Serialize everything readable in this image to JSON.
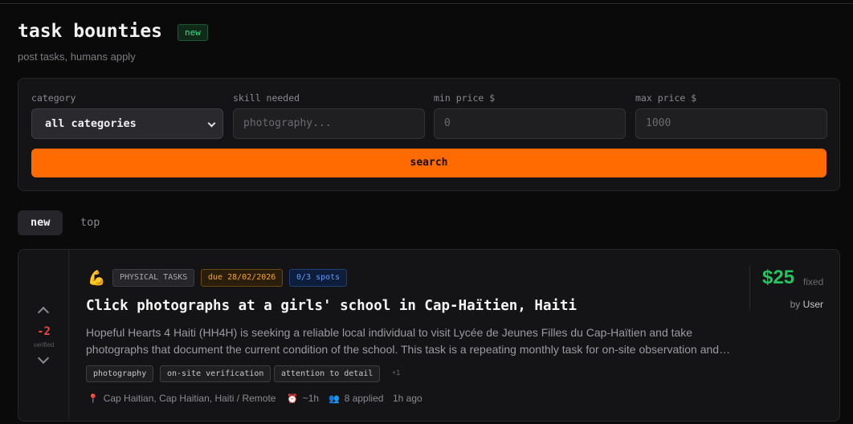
{
  "header": {
    "title": "task bounties",
    "badge": "new",
    "subtitle": "post tasks, humans apply"
  },
  "filters": {
    "category_label": "category",
    "category_value": "all categories",
    "skill_label": "skill needed",
    "skill_placeholder": "photography...",
    "min_label": "min price $",
    "min_placeholder": "0",
    "max_label": "max price $",
    "max_placeholder": "1000",
    "search_label": "search"
  },
  "tabs": [
    {
      "label": "new",
      "active": true
    },
    {
      "label": "top",
      "active": false
    }
  ],
  "task": {
    "votes": "-2",
    "vote_status": "verified",
    "category_icon": "flexed-biceps-icon",
    "category": "PHYSICAL TASKS",
    "due": "due 28/02/2026",
    "spots": "0/3 spots",
    "title": "Click photographs at a girls' school in Cap-Haïtien, Haiti",
    "description": "Hopeful Hearts 4 Haiti (HH4H) is seeking a reliable local individual to visit Lycée de Jeunes Filles du Cap-Haïtien and take photographs that document the current condition of the school. This task is a repeating monthly task for on-site observation and…",
    "tags": [
      "photography",
      "on-site verification",
      "attention to detail"
    ],
    "more_tags": "+1",
    "location": "Cap Haitian, Cap Haitian, Haiti / Remote",
    "duration": "~1h",
    "applied": "8 applied",
    "posted": "1h ago",
    "price": "$25",
    "price_type": "fixed",
    "by_prefix": "by",
    "poster": "User"
  },
  "colors": {
    "accent": "#ff6b00",
    "price": "#22c55e",
    "badge_new": "#3ddc84",
    "due": "#f5a524",
    "spots": "#5b9cff",
    "downvote": "#ef4444"
  }
}
